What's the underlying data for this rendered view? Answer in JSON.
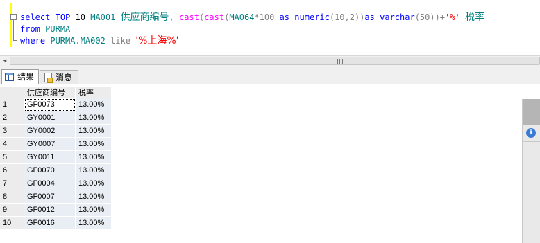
{
  "editor": {
    "line1": {
      "kw_select": "select",
      "kw_top": "TOP",
      "num": "10",
      "col": "MA001",
      "alias": "供应商编号",
      "comma": ",",
      "fn_cast1": "cast",
      "paren_a": "(",
      "fn_cast2": "cast",
      "paren_b": "(",
      "col2": "MA064",
      "op_mul": "*100",
      "kw_as1": "as",
      "type_numeric": "numeric",
      "args_numeric": "(10,2))",
      "kw_as2": "as",
      "type_varchar": "varchar",
      "args_varchar": "(50))+",
      "str_percent": "'%'",
      "alias2": "税率"
    },
    "line2": {
      "kw_from": "from",
      "table": "PURMA"
    },
    "line3": {
      "kw_where": "where",
      "col": "PURMA.MA002",
      "kw_like": "like",
      "pattern": "'%上海%'"
    }
  },
  "tabs": [
    {
      "label": "结果",
      "icon": "grid-icon",
      "active": true
    },
    {
      "label": "消息",
      "icon": "message-icon",
      "active": false
    }
  ],
  "results": {
    "columns": [
      "供应商编号",
      "税率"
    ],
    "rows": [
      {
        "n": "1",
        "code": "GF0073",
        "rate": "13.00%"
      },
      {
        "n": "2",
        "code": "GY0001",
        "rate": "13.00%"
      },
      {
        "n": "3",
        "code": "GY0002",
        "rate": "13.00%"
      },
      {
        "n": "4",
        "code": "GY0007",
        "rate": "13.00%"
      },
      {
        "n": "5",
        "code": "GY0011",
        "rate": "13.00%"
      },
      {
        "n": "6",
        "code": "GF0070",
        "rate": "13.00%"
      },
      {
        "n": "7",
        "code": "GF0004",
        "rate": "13.00%"
      },
      {
        "n": "8",
        "code": "GF0007",
        "rate": "13.00%"
      },
      {
        "n": "9",
        "code": "GF0012",
        "rate": "13.00%"
      },
      {
        "n": "10",
        "code": "GF0016",
        "rate": "13.00%"
      }
    ]
  },
  "colors": {
    "keyword": "#0000ff",
    "identifier": "#008080",
    "function": "#ff00ff",
    "string": "#ff0000",
    "gutter": "#ffff00"
  },
  "icons": {
    "scroll_left": "scroll-left-arrow-icon",
    "info": "info-icon"
  },
  "scroll_left_glyph": "◂",
  "info_glyph": "i"
}
